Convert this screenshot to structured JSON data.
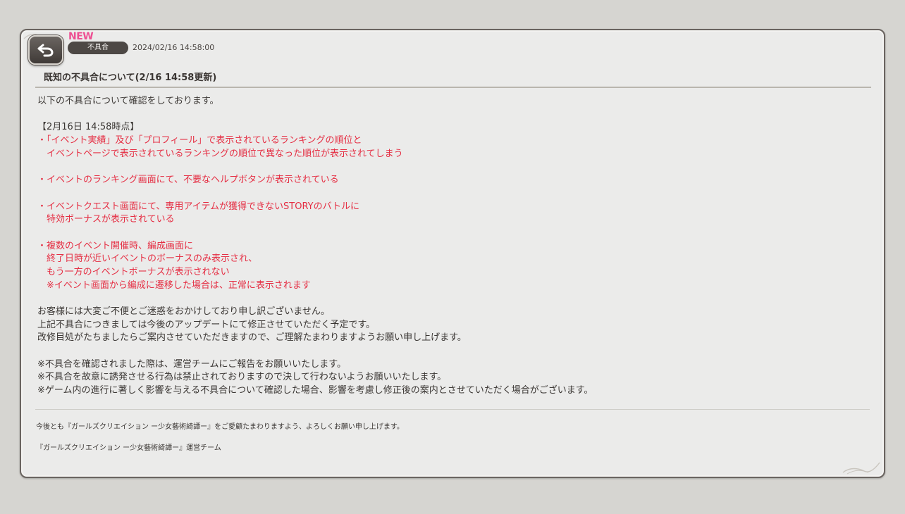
{
  "header": {
    "new_label": "NEW",
    "category": "不具合",
    "timestamp": "2024/02/16 14:58:00",
    "title": "既知の不具合について(2/16 14:58更新)"
  },
  "body_lines": [
    {
      "text": "以下の不具合について確認をしております。",
      "color": "normal"
    },
    {
      "text": "",
      "color": "normal"
    },
    {
      "text": "【2月16日 14:58時点】",
      "color": "normal"
    },
    {
      "text": "・「イベント実績」及び「プロフィール」で表示されているランキングの順位と",
      "color": "red"
    },
    {
      "text": "　イベントページで表示されているランキングの順位で異なった順位が表示されてしまう",
      "color": "red"
    },
    {
      "text": "",
      "color": "normal"
    },
    {
      "text": "・イベントのランキング画面にて、不要なヘルプボタンが表示されている",
      "color": "red"
    },
    {
      "text": "",
      "color": "normal"
    },
    {
      "text": "・イベントクエスト画面にて、専用アイテムが獲得できないSTORYのバトルに",
      "color": "red"
    },
    {
      "text": "　特効ボーナスが表示されている",
      "color": "red"
    },
    {
      "text": "",
      "color": "normal"
    },
    {
      "text": "・複数のイベント開催時、編成画面に",
      "color": "red"
    },
    {
      "text": "　終了日時が近いイベントのボーナスのみ表示され、",
      "color": "red"
    },
    {
      "text": "　もう一方のイベントボーナスが表示されない",
      "color": "red"
    },
    {
      "text": "　※イベント画面から編成に遷移した場合は、正常に表示されます",
      "color": "red"
    },
    {
      "text": "",
      "color": "normal"
    },
    {
      "text": "お客様には大変ご不便とご迷惑をおかけしており申し訳ございません。",
      "color": "normal"
    },
    {
      "text": "上記不具合につきましては今後のアップデートにて修正させていただく予定です。",
      "color": "normal"
    },
    {
      "text": "改修目処がたちましたらご案内させていただきますので、ご理解たまわりますようお願い申し上げます。",
      "color": "normal"
    },
    {
      "text": "",
      "color": "normal"
    },
    {
      "text": "※不具合を確認されました際は、運営チームにご報告をお願いいたします。",
      "color": "normal"
    },
    {
      "text": "※不具合を故意に誘発させる行為は禁止されておりますので決して行わないようお願いいたします。",
      "color": "normal"
    },
    {
      "text": "※ゲーム内の進行に著しく影響を与える不具合について確認した場合、影響を考慮し修正後の案内とさせていただく場合がございます。",
      "color": "normal"
    }
  ],
  "footer": {
    "line1": "今後とも『ガールズクリエイション ー少女藝術綺譚ー』をご愛顧たまわりますよう、よろしくお願い申し上げます。",
    "line2": "『ガールズクリエイション ー少女藝術綺譚ー』運営チーム"
  },
  "colors": {
    "accent_red": "#e52e43",
    "new_pink": "#ee4f92",
    "badge_bg": "#4d4845"
  },
  "icons": {
    "back": "back-arrow-icon"
  }
}
